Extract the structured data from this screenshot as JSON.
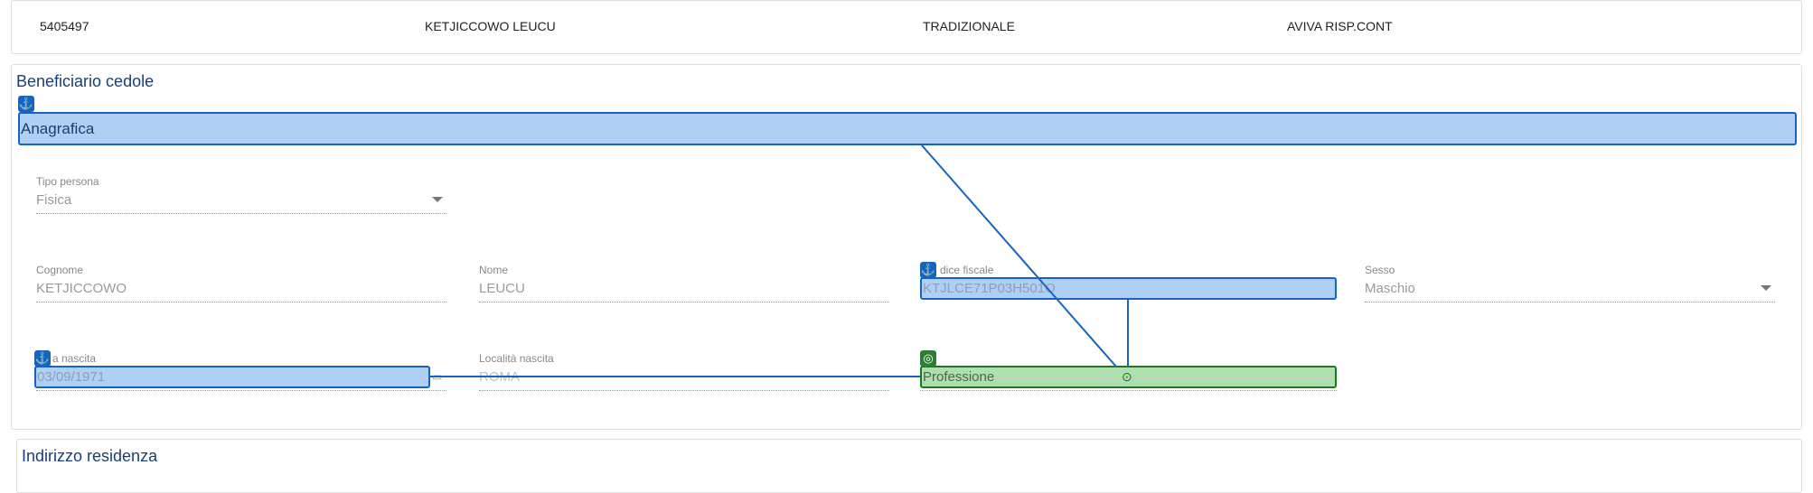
{
  "summary_row": {
    "policy_number": "5405497",
    "client_name": "KETJICCOWO LEUCU",
    "product_type": "TRADIZIONALE",
    "product_name": "AVIVA RISP.CONT"
  },
  "beneficiary_section": {
    "title": "Beneficiario cedole",
    "anagrafica_label": "Anagrafica",
    "fields": {
      "tipo_persona": {
        "label": "Tipo persona",
        "value": "Fisica"
      },
      "cognome": {
        "label": "Cognome",
        "value": "KETJICCOWO"
      },
      "nome": {
        "label": "Nome",
        "value": "LEUCU"
      },
      "codice_fiscale": {
        "label": "dice fiscale",
        "value": "KTJLCE71P03H501O"
      },
      "sesso": {
        "label": "Sesso",
        "value": "Maschio"
      },
      "data_nascita": {
        "label": "a nascita",
        "value": "03/09/1971"
      },
      "localita_nascita": {
        "label": "Località nascita",
        "value": "ROMA"
      },
      "professione": {
        "label": "Professione"
      }
    }
  },
  "address_section": {
    "title": "Indirizzo residenza"
  },
  "icons": {
    "anchor": "⚓",
    "target": "◎",
    "crosshair": "⊙",
    "calendar": "▭"
  },
  "colors": {
    "highlight_blue": "#1565c0",
    "highlight_green": "#2e7d32",
    "section_title": "#1a3f73"
  }
}
